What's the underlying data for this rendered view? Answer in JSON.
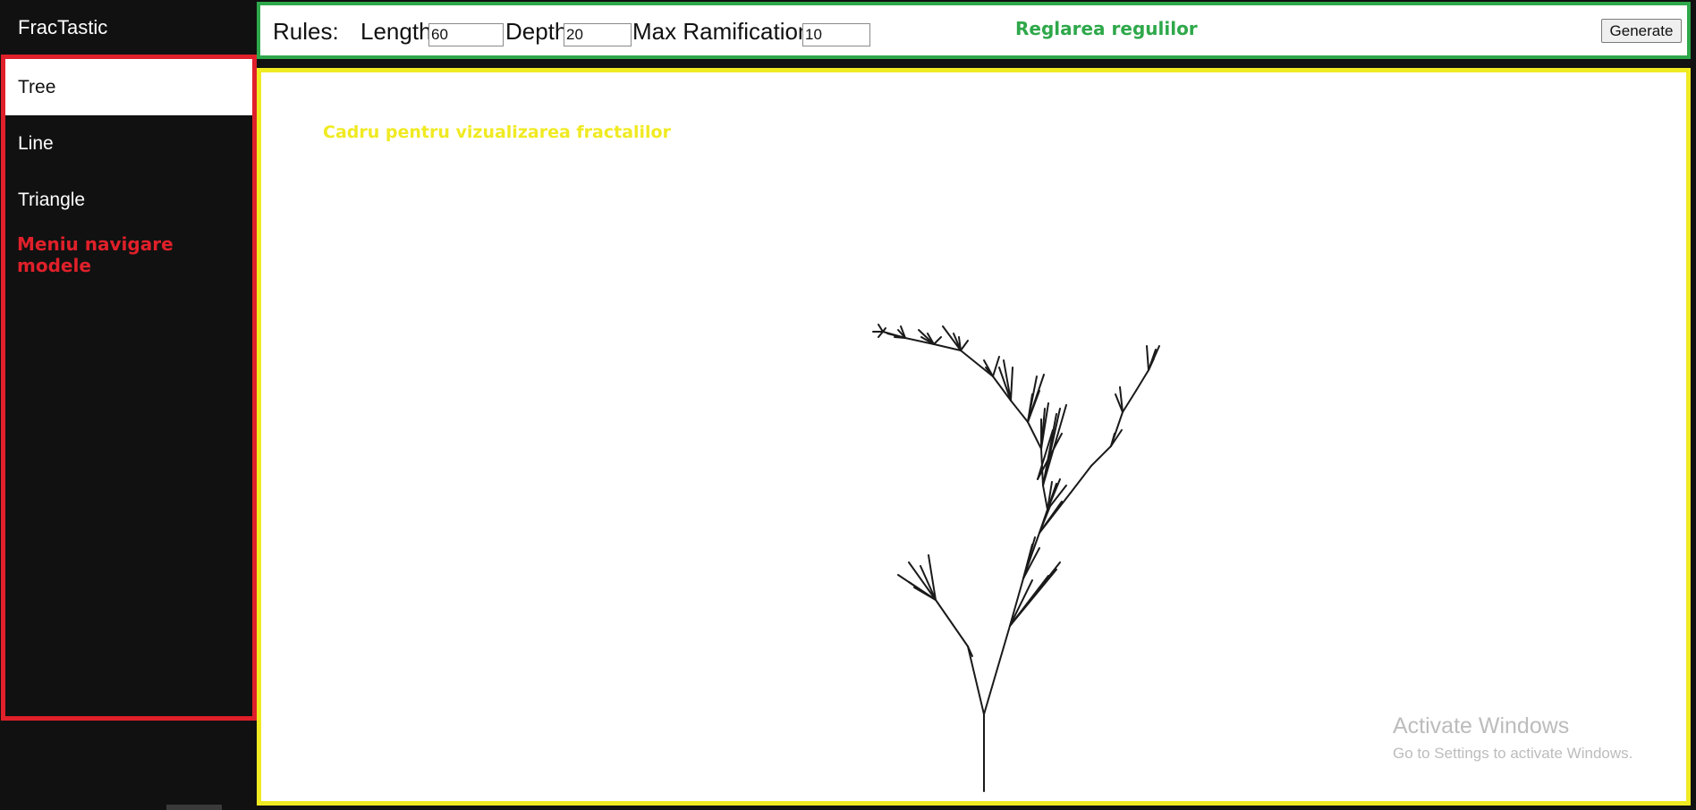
{
  "app": {
    "title": "FracTastic"
  },
  "sidebar": {
    "items": [
      {
        "label": "Tree",
        "active": true
      },
      {
        "label": "Line",
        "active": false
      },
      {
        "label": "Triangle",
        "active": false
      }
    ],
    "annotation": "Meniu navigare modele"
  },
  "rules": {
    "title": "Rules:",
    "length_label": "Length",
    "length_value": "60",
    "depth_label": "Depth",
    "depth_value": "20",
    "max_ramification_label": "Max Ramification",
    "max_ramification_value": "10",
    "annotation": "Reglarea regulilor",
    "generate_label": "Generate"
  },
  "canvas": {
    "annotation": "Cadru pentru vizualizarea fractalilor"
  },
  "watermark": {
    "title": "Activate Windows",
    "subtitle": "Go to Settings to activate Windows."
  },
  "colors": {
    "sidebar_bg": "#111111",
    "nav_border": "#e0202a",
    "rules_border": "#2ea84a",
    "canvas_border": "#f0ea22",
    "fractal_stroke": "#1a1a1a"
  }
}
